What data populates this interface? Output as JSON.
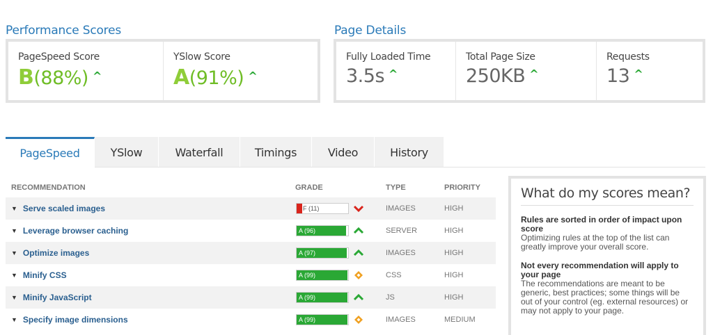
{
  "performance": {
    "title": "Performance Scores",
    "pagespeed": {
      "label": "PageSpeed Score",
      "grade": "B",
      "percent": "(88%)"
    },
    "yslow": {
      "label": "YSlow Score",
      "grade": "A",
      "percent": "(91%)"
    }
  },
  "details": {
    "title": "Page Details",
    "load_time": {
      "label": "Fully Loaded Time",
      "value": "3.5s"
    },
    "page_size": {
      "label": "Total Page Size",
      "value": "250KB"
    },
    "requests": {
      "label": "Requests",
      "value": "13"
    }
  },
  "trend_symbol": "^",
  "tabs": [
    "PageSpeed",
    "YSlow",
    "Waterfall",
    "Timings",
    "Video",
    "History"
  ],
  "active_tab": "PageSpeed",
  "table": {
    "headers": {
      "recommendation": "RECOMMENDATION",
      "grade": "GRADE",
      "type": "TYPE",
      "priority": "PRIORITY"
    },
    "rows": [
      {
        "name": "Serve scaled images",
        "grade_text": "F (11)",
        "score": 11,
        "bar_color": "#d9241c",
        "indicator": "chevron-down",
        "indicator_color": "#d9241c",
        "type": "IMAGES",
        "priority": "HIGH"
      },
      {
        "name": "Leverage browser caching",
        "grade_text": "A (96)",
        "score": 96,
        "bar_color": "#2aa835",
        "indicator": "chevron-up",
        "indicator_color": "#2aa835",
        "type": "SERVER",
        "priority": "HIGH"
      },
      {
        "name": "Optimize images",
        "grade_text": "A (97)",
        "score": 97,
        "bar_color": "#2aa835",
        "indicator": "chevron-up",
        "indicator_color": "#2aa835",
        "type": "IMAGES",
        "priority": "HIGH"
      },
      {
        "name": "Minify CSS",
        "grade_text": "A (99)",
        "score": 99,
        "bar_color": "#2aa835",
        "indicator": "diamond",
        "indicator_color": "#f0a020",
        "type": "CSS",
        "priority": "HIGH"
      },
      {
        "name": "Minify JavaScript",
        "grade_text": "A (99)",
        "score": 99,
        "bar_color": "#2aa835",
        "indicator": "chevron-up",
        "indicator_color": "#2aa835",
        "type": "JS",
        "priority": "HIGH"
      },
      {
        "name": "Specify image dimensions",
        "grade_text": "A (99)",
        "score": 99,
        "bar_color": "#2aa835",
        "indicator": "diamond",
        "indicator_color": "#f0a020",
        "type": "IMAGES",
        "priority": "MEDIUM"
      }
    ]
  },
  "sidebar": {
    "title": "What do my scores mean?",
    "blocks": [
      {
        "heading": "Rules are sorted in order of impact upon score",
        "body": "Optimizing rules at the top of the list can greatly improve your overall score."
      },
      {
        "heading": "Not every recommendation will apply to your page",
        "body": "The recommendations are meant to be generic, best practices; some things will be out of your control (eg. external resources) or may not apply to your page."
      }
    ]
  }
}
